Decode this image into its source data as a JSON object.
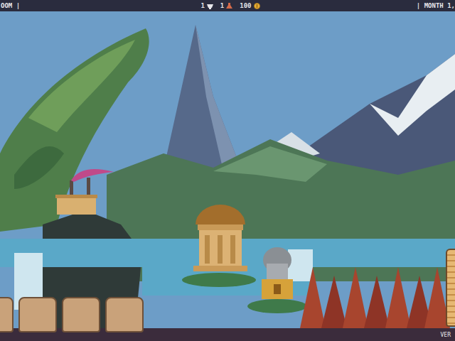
{
  "top_bar": {
    "left": "OOM |",
    "resources": [
      {
        "value": "1",
        "kind": "cup"
      },
      {
        "value": "1",
        "kind": "flask"
      },
      {
        "value": "100",
        "kind": "coin"
      }
    ],
    "right": "| MONTH 1,"
  },
  "inventory_slots": [
    {
      "filled": false
    },
    {
      "filled": false
    },
    {
      "filled": false
    },
    {
      "filled": false
    }
  ],
  "corner_label": "VER"
}
